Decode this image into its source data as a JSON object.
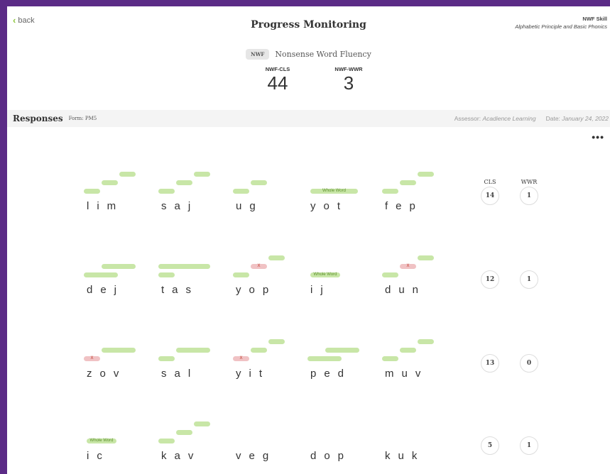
{
  "nav": {
    "back_label": "back"
  },
  "header": {
    "title": "Progress Monitoring"
  },
  "skill": {
    "title": "NWF Skill",
    "subtitle": "Alphabetic Principle and Basic Phonics"
  },
  "measure": {
    "badge": "NWF",
    "name": "Nonsense Word Fluency"
  },
  "scores": [
    {
      "label": "NWF-CLS",
      "value": "44"
    },
    {
      "label": "NWF-WWR",
      "value": "3"
    }
  ],
  "responses": {
    "title": "Responses",
    "form": "Form: PM5",
    "assessor_label": "Assessor:",
    "assessor": "Acadience Learning",
    "date_label": "Date:",
    "date": "January 24, 2022",
    "more_label": "•••"
  },
  "columns": {
    "cls": "CLS",
    "wwr": "WWR"
  },
  "rows": [
    {
      "cls": "14",
      "wwr": "1",
      "words": [
        {
          "letters": "lim",
          "bars": [
            [
              0,
              1,
              "ok"
            ],
            [
              1,
              1,
              "ok"
            ],
            [
              2,
              1,
              "ok"
            ]
          ],
          "whole": ""
        },
        {
          "letters": "saj",
          "bars": [
            [
              0,
              1,
              "ok"
            ],
            [
              1,
              1,
              "ok"
            ],
            [
              2,
              1,
              "ok"
            ]
          ],
          "whole": ""
        },
        {
          "letters": "ug",
          "bars": [
            [
              0,
              1,
              "ok"
            ],
            [
              1,
              1,
              "ok"
            ]
          ],
          "whole": ""
        },
        {
          "letters": "yot",
          "bars": [],
          "whole": "Whole Word"
        },
        {
          "letters": "fep",
          "bars": [
            [
              0,
              1,
              "ok"
            ],
            [
              1,
              1,
              "ok"
            ],
            [
              2,
              1,
              "ok"
            ]
          ],
          "whole": ""
        }
      ]
    },
    {
      "cls": "12",
      "wwr": "1",
      "words": [
        {
          "letters": "dej",
          "bars": [
            [
              0,
              2,
              "ok"
            ],
            [
              1,
              2,
              "ok"
            ]
          ],
          "whole": ""
        },
        {
          "letters": "tas",
          "bars": [
            [
              0,
              1,
              "ok"
            ],
            [
              0,
              3,
              "ok"
            ]
          ],
          "whole": ""
        },
        {
          "letters": "yop",
          "bars": [
            [
              0,
              1,
              "ok"
            ],
            [
              1,
              1,
              "err"
            ],
            [
              2,
              1,
              "ok"
            ]
          ],
          "whole": ""
        },
        {
          "letters": "ij",
          "bars": [],
          "whole": "Whole Word"
        },
        {
          "letters": "dun",
          "bars": [
            [
              0,
              1,
              "ok"
            ],
            [
              1,
              1,
              "err"
            ],
            [
              2,
              1,
              "ok"
            ]
          ],
          "whole": ""
        }
      ]
    },
    {
      "cls": "13",
      "wwr": "0",
      "words": [
        {
          "letters": "zov",
          "bars": [
            [
              0,
              1,
              "err"
            ],
            [
              1,
              2,
              "ok"
            ]
          ],
          "whole": ""
        },
        {
          "letters": "sal",
          "bars": [
            [
              0,
              1,
              "ok"
            ],
            [
              1,
              2,
              "ok"
            ]
          ],
          "whole": ""
        },
        {
          "letters": "yit",
          "bars": [
            [
              0,
              1,
              "err"
            ],
            [
              1,
              1,
              "ok"
            ],
            [
              2,
              1,
              "ok"
            ]
          ],
          "whole": ""
        },
        {
          "letters": "ped",
          "bars": [
            [
              0,
              2,
              "ok"
            ],
            [
              1,
              2,
              "ok"
            ]
          ],
          "whole": ""
        },
        {
          "letters": "muv",
          "bars": [
            [
              0,
              1,
              "ok"
            ],
            [
              1,
              1,
              "ok"
            ],
            [
              2,
              1,
              "ok"
            ]
          ],
          "whole": ""
        }
      ]
    },
    {
      "cls": "5",
      "wwr": "1",
      "words": [
        {
          "letters": "ic",
          "bars": [],
          "whole": "Whole Word"
        },
        {
          "letters": "kav",
          "bars": [
            [
              0,
              1,
              "ok"
            ],
            [
              1,
              1,
              "ok"
            ],
            [
              2,
              1,
              "ok"
            ]
          ],
          "whole": ""
        },
        {
          "letters": "veg",
          "bars": [],
          "whole": ""
        },
        {
          "letters": "dop",
          "bars": [],
          "whole": ""
        },
        {
          "letters": "kuk",
          "bars": [],
          "whole": ""
        }
      ]
    }
  ],
  "error_mark": "X",
  "colors": {
    "frame": "#5b2b86",
    "correct": "#c8e6a7",
    "error": "#f0c2c4",
    "back_chevron": "#8ec63f"
  }
}
